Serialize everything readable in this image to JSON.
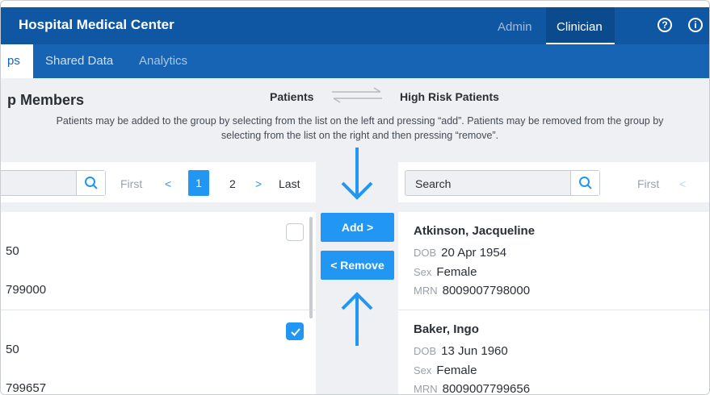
{
  "header": {
    "title": "Hospital Medical Center",
    "roles": [
      "Admin",
      "Clinician"
    ],
    "active_role": "Clinician",
    "help_icon_glyph": "?",
    "info_icon_glyph": "i"
  },
  "tabs": {
    "groups": "ps",
    "shared_data": "Shared Data",
    "analytics": "Analytics"
  },
  "page": {
    "title": "p Members",
    "source_list_label": "Patients",
    "target_list_label": "High Risk Patients",
    "instructions_line1": "Patients may be added to the group by selecting from the list on the left and pressing “add”. Patients may be removed from the group by",
    "instructions_line2": "selecting from the list on the right and then pressing “remove”."
  },
  "left_panel": {
    "search_value": "",
    "pagination": {
      "first": "First",
      "prev": "<",
      "pages": [
        "1",
        "2"
      ],
      "current_page": "1",
      "next": ">",
      "last": "Last"
    },
    "items": [
      {
        "dob_fragment": "50",
        "mrn_fragment": "799000",
        "checked": false
      },
      {
        "dob_fragment": "50",
        "mrn_fragment": "799657",
        "checked": true
      }
    ]
  },
  "transfer_buttons": {
    "add": "Add >",
    "remove": "< Remove"
  },
  "right_panel": {
    "search_placeholder": "Search",
    "pagination": {
      "first": "First",
      "prev": "<"
    },
    "field_labels": {
      "dob": "DOB",
      "sex": "Sex",
      "mrn": "MRN"
    },
    "items": [
      {
        "name": "Atkinson, Jacqueline",
        "dob": "20 Apr 1954",
        "sex": "Female",
        "mrn": "8009007798000"
      },
      {
        "name": "Baker, Ingo",
        "dob": "13 Jun 1960",
        "sex": "Female",
        "mrn": "8009007799656"
      }
    ]
  },
  "colors": {
    "header_bg": "#0f57a3",
    "tabbar_bg": "#1764b5",
    "accent": "#2196f3",
    "content_bg": "#eef0f3"
  },
  "icons": [
    "help-circle-icon",
    "info-circle-icon",
    "swap-arrows-icon",
    "search-icon",
    "checkmark-icon",
    "arrow-down-icon",
    "arrow-up-icon"
  ]
}
